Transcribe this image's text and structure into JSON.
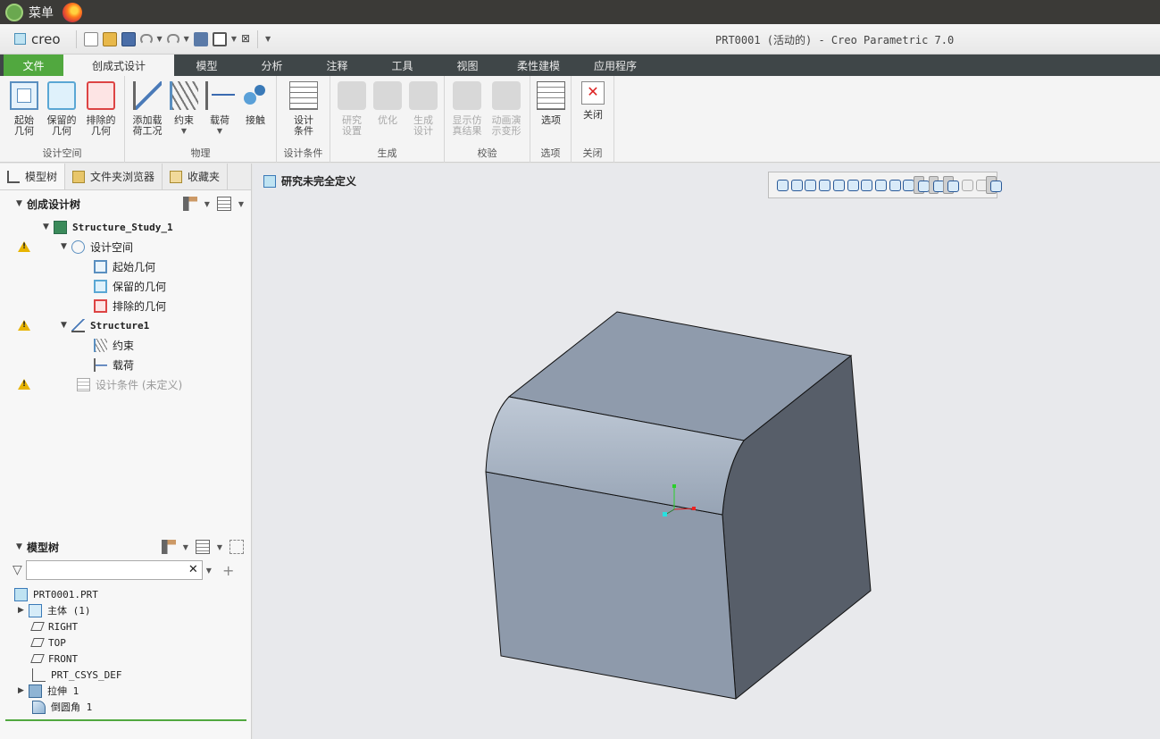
{
  "os": {
    "menu_label": "菜单"
  },
  "app": {
    "brand": "creo",
    "window_title": "PRT0001 (活动的) - Creo Parametric 7.0"
  },
  "tabs": [
    {
      "label": "文件"
    },
    {
      "label": "创成式设计"
    },
    {
      "label": "模型"
    },
    {
      "label": "分析"
    },
    {
      "label": "注释"
    },
    {
      "label": "工具"
    },
    {
      "label": "视图"
    },
    {
      "label": "柔性建模"
    },
    {
      "label": "应用程序"
    }
  ],
  "ribbon": {
    "groups": {
      "design_space": "设计空间",
      "physics": "物理",
      "design_conditions": "设计条件",
      "generate": "生成",
      "validate": "校验",
      "options": "选项",
      "close": "关闭"
    },
    "buttons": {
      "start_geometry": [
        "起始",
        "几何"
      ],
      "keep_geometry": [
        "保留的",
        "几何"
      ],
      "exclude_geometry": [
        "排除的",
        "几何"
      ],
      "add_load_case": [
        "添加载",
        "荷工况"
      ],
      "constraint": [
        "约束",
        ""
      ],
      "load": [
        "载荷",
        ""
      ],
      "contact": [
        "接触",
        ""
      ],
      "design_criteria": [
        "设计",
        "条件"
      ],
      "study_setup": [
        "研究",
        "设置"
      ],
      "optimize": [
        "优化",
        ""
      ],
      "generate_design": [
        "生成",
        "设计"
      ],
      "show_results": [
        "显示仿",
        "真结果"
      ],
      "animate_deform": [
        "动画演",
        "示变形"
      ],
      "options": [
        "选项",
        ""
      ],
      "close": [
        "关闭",
        ""
      ]
    }
  },
  "left_panel": {
    "tabs": [
      "模型树",
      "文件夹浏览器",
      "收藏夹"
    ],
    "gd_tree": {
      "title": "创成设计树",
      "nodes": {
        "study": "Structure_Study_1",
        "design_space": "设计空间",
        "start_geo": "起始几何",
        "keep_geo": "保留的几何",
        "excl_geo": "排除的几何",
        "structure": "Structure1",
        "constraint": "约束",
        "load": "载荷",
        "design_cond": "设计条件 (未定义)"
      }
    },
    "model_tree": {
      "title": "模型树",
      "search_value": "",
      "nodes": {
        "part": "PRT0001.PRT",
        "body": "主体 (1)",
        "right": "RIGHT",
        "top": "TOP",
        "front": "FRONT",
        "csys": "PRT_CSYS_DEF",
        "extrude": "拉伸 1",
        "round": "倒圆角 1"
      }
    }
  },
  "graphics": {
    "status_message": "研究未完全定义"
  },
  "colors": {
    "file_tab": "#51a83f",
    "tab_bar": "#3f4648",
    "model_front": "#8e9aab",
    "model_side": "#575e69",
    "model_top": "#8f9bac",
    "warning": "#e8b400"
  }
}
